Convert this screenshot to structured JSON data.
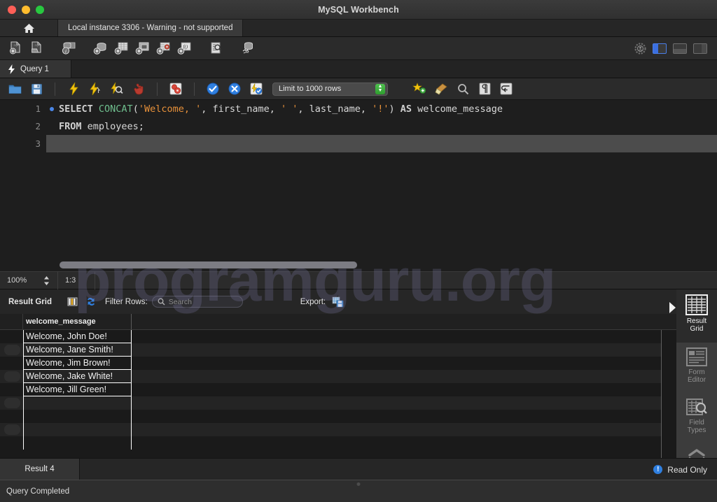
{
  "window": {
    "title": "MySQL Workbench",
    "traffic_lights": [
      "close-red",
      "minimize-yellow",
      "maximize-green"
    ]
  },
  "tabstrip": {
    "home_icon": "home-icon",
    "connection_tab": "Local instance 3306 - Warning - not supported"
  },
  "main_toolbar": {
    "buttons": [
      {
        "name": "new-sql-tab-icon",
        "title": "New SQL Tab"
      },
      {
        "name": "open-sql-script-icon",
        "title": "Open SQL Script"
      },
      {
        "name": "connection-info-icon",
        "title": "Connection Info"
      },
      {
        "name": "new-schema-icon",
        "title": "Create New Schema"
      },
      {
        "name": "new-table-icon",
        "title": "Create New Table"
      },
      {
        "name": "new-view-icon",
        "title": "Create New View"
      },
      {
        "name": "new-procedure-icon",
        "title": "Create New Procedure"
      },
      {
        "name": "new-function-icon",
        "title": "Create New Function"
      },
      {
        "name": "inspect-schema-icon",
        "title": "Schema Inspector"
      },
      {
        "name": "reconnect-dbms-icon",
        "title": "Reconnect to DBMS"
      }
    ],
    "right_buttons": [
      {
        "name": "admin-settings-icon",
        "active": false
      },
      {
        "name": "toggle-sidebar-icon",
        "active": true
      },
      {
        "name": "toggle-output-panel-icon",
        "active": false
      },
      {
        "name": "toggle-secondary-sidebar-icon",
        "active": false
      }
    ]
  },
  "query_tabs": [
    {
      "label": "Query 1",
      "icon": "lightning-icon",
      "active": true
    }
  ],
  "editor_toolbar": {
    "buttons": [
      {
        "name": "open-file-icon"
      },
      {
        "name": "save-file-icon"
      },
      {
        "name": "execute-statement-icon"
      },
      {
        "name": "execute-current-statement-icon"
      },
      {
        "name": "explain-statement-icon"
      },
      {
        "name": "stop-execution-icon"
      },
      {
        "name": "toggle-stop-on-error-icon"
      },
      {
        "name": "commit-transaction-icon"
      },
      {
        "name": "rollback-transaction-icon"
      },
      {
        "name": "toggle-autocommit-icon"
      }
    ],
    "limit_select": {
      "label": "Limit to 1000 rows",
      "stepper": "stepper-icon"
    },
    "right_buttons": [
      {
        "name": "beautify-sql-icon"
      },
      {
        "name": "clear-sql-icon"
      },
      {
        "name": "find-icon"
      },
      {
        "name": "toggle-invisible-chars-icon"
      },
      {
        "name": "toggle-word-wrap-icon"
      }
    ]
  },
  "editor": {
    "lines": [
      {
        "number": "1",
        "breakpoint": true,
        "tokens": [
          {
            "t": "SELECT ",
            "c": "kw"
          },
          {
            "t": "CONCAT",
            "c": "fn"
          },
          {
            "t": "(",
            "c": "pl"
          },
          {
            "t": "'Welcome, '",
            "c": "str"
          },
          {
            "t": ", first_name, ",
            "c": "pl"
          },
          {
            "t": "' '",
            "c": "str"
          },
          {
            "t": ", last_name, ",
            "c": "pl"
          },
          {
            "t": "'!'",
            "c": "str"
          },
          {
            "t": ") ",
            "c": "pl"
          },
          {
            "t": "AS ",
            "c": "kw"
          },
          {
            "t": "welcome_message",
            "c": "pl"
          }
        ]
      },
      {
        "number": "2",
        "breakpoint": false,
        "tokens": [
          {
            "t": "FROM ",
            "c": "kw"
          },
          {
            "t": "employees;",
            "c": "pl"
          }
        ]
      },
      {
        "number": "3",
        "breakpoint": false,
        "current": true,
        "tokens": []
      }
    ]
  },
  "zoom_bar": {
    "zoom_level": "100%",
    "stepper_icon": "updown-stepper-icon",
    "cursor_position": "1:3"
  },
  "result_toolbar": {
    "title": "Result Grid",
    "grid_view_icon": "grid-columns-icon",
    "refresh_icon": "refresh-icon",
    "filter_label": "Filter Rows:",
    "search_placeholder": "Search",
    "search_value": "",
    "search_icon": "magnifier-icon",
    "export_label": "Export:",
    "export_icon": "export-recordset-icon"
  },
  "result_grid": {
    "columns": [
      "welcome_message"
    ],
    "rows": [
      [
        "Welcome, John Doe!"
      ],
      [
        "Welcome, Jane Smith!"
      ],
      [
        "Welcome, Jim Brown!"
      ],
      [
        "Welcome, Jake White!"
      ],
      [
        "Welcome, Jill Green!"
      ]
    ]
  },
  "side_panel": {
    "items": [
      {
        "label_line1": "Result",
        "label_line2": "Grid",
        "icon": "result-grid-icon",
        "active": true
      },
      {
        "label_line1": "Form",
        "label_line2": "Editor",
        "icon": "form-editor-icon",
        "active": false
      },
      {
        "label_line1": "Field",
        "label_line2": "Types",
        "icon": "field-types-icon",
        "active": false
      }
    ],
    "expand_icon": "chevron-updown-icon",
    "collapse_arrow_icon": "right-arrow-icon"
  },
  "result_tabs": [
    {
      "label": "Result 4",
      "active": true
    }
  ],
  "read_only": {
    "label": "Read Only",
    "icon": "info-icon"
  },
  "status_bar": {
    "message": "Query Completed"
  },
  "watermark": {
    "text": "programguru.org",
    "color": "#8d8cc0"
  },
  "colors": {
    "accent_blue": "#3b6fe0",
    "keyword": "#cfcfcf",
    "function": "#6fbf8e",
    "string": "#e8913a",
    "background": "#1e1e1e"
  }
}
